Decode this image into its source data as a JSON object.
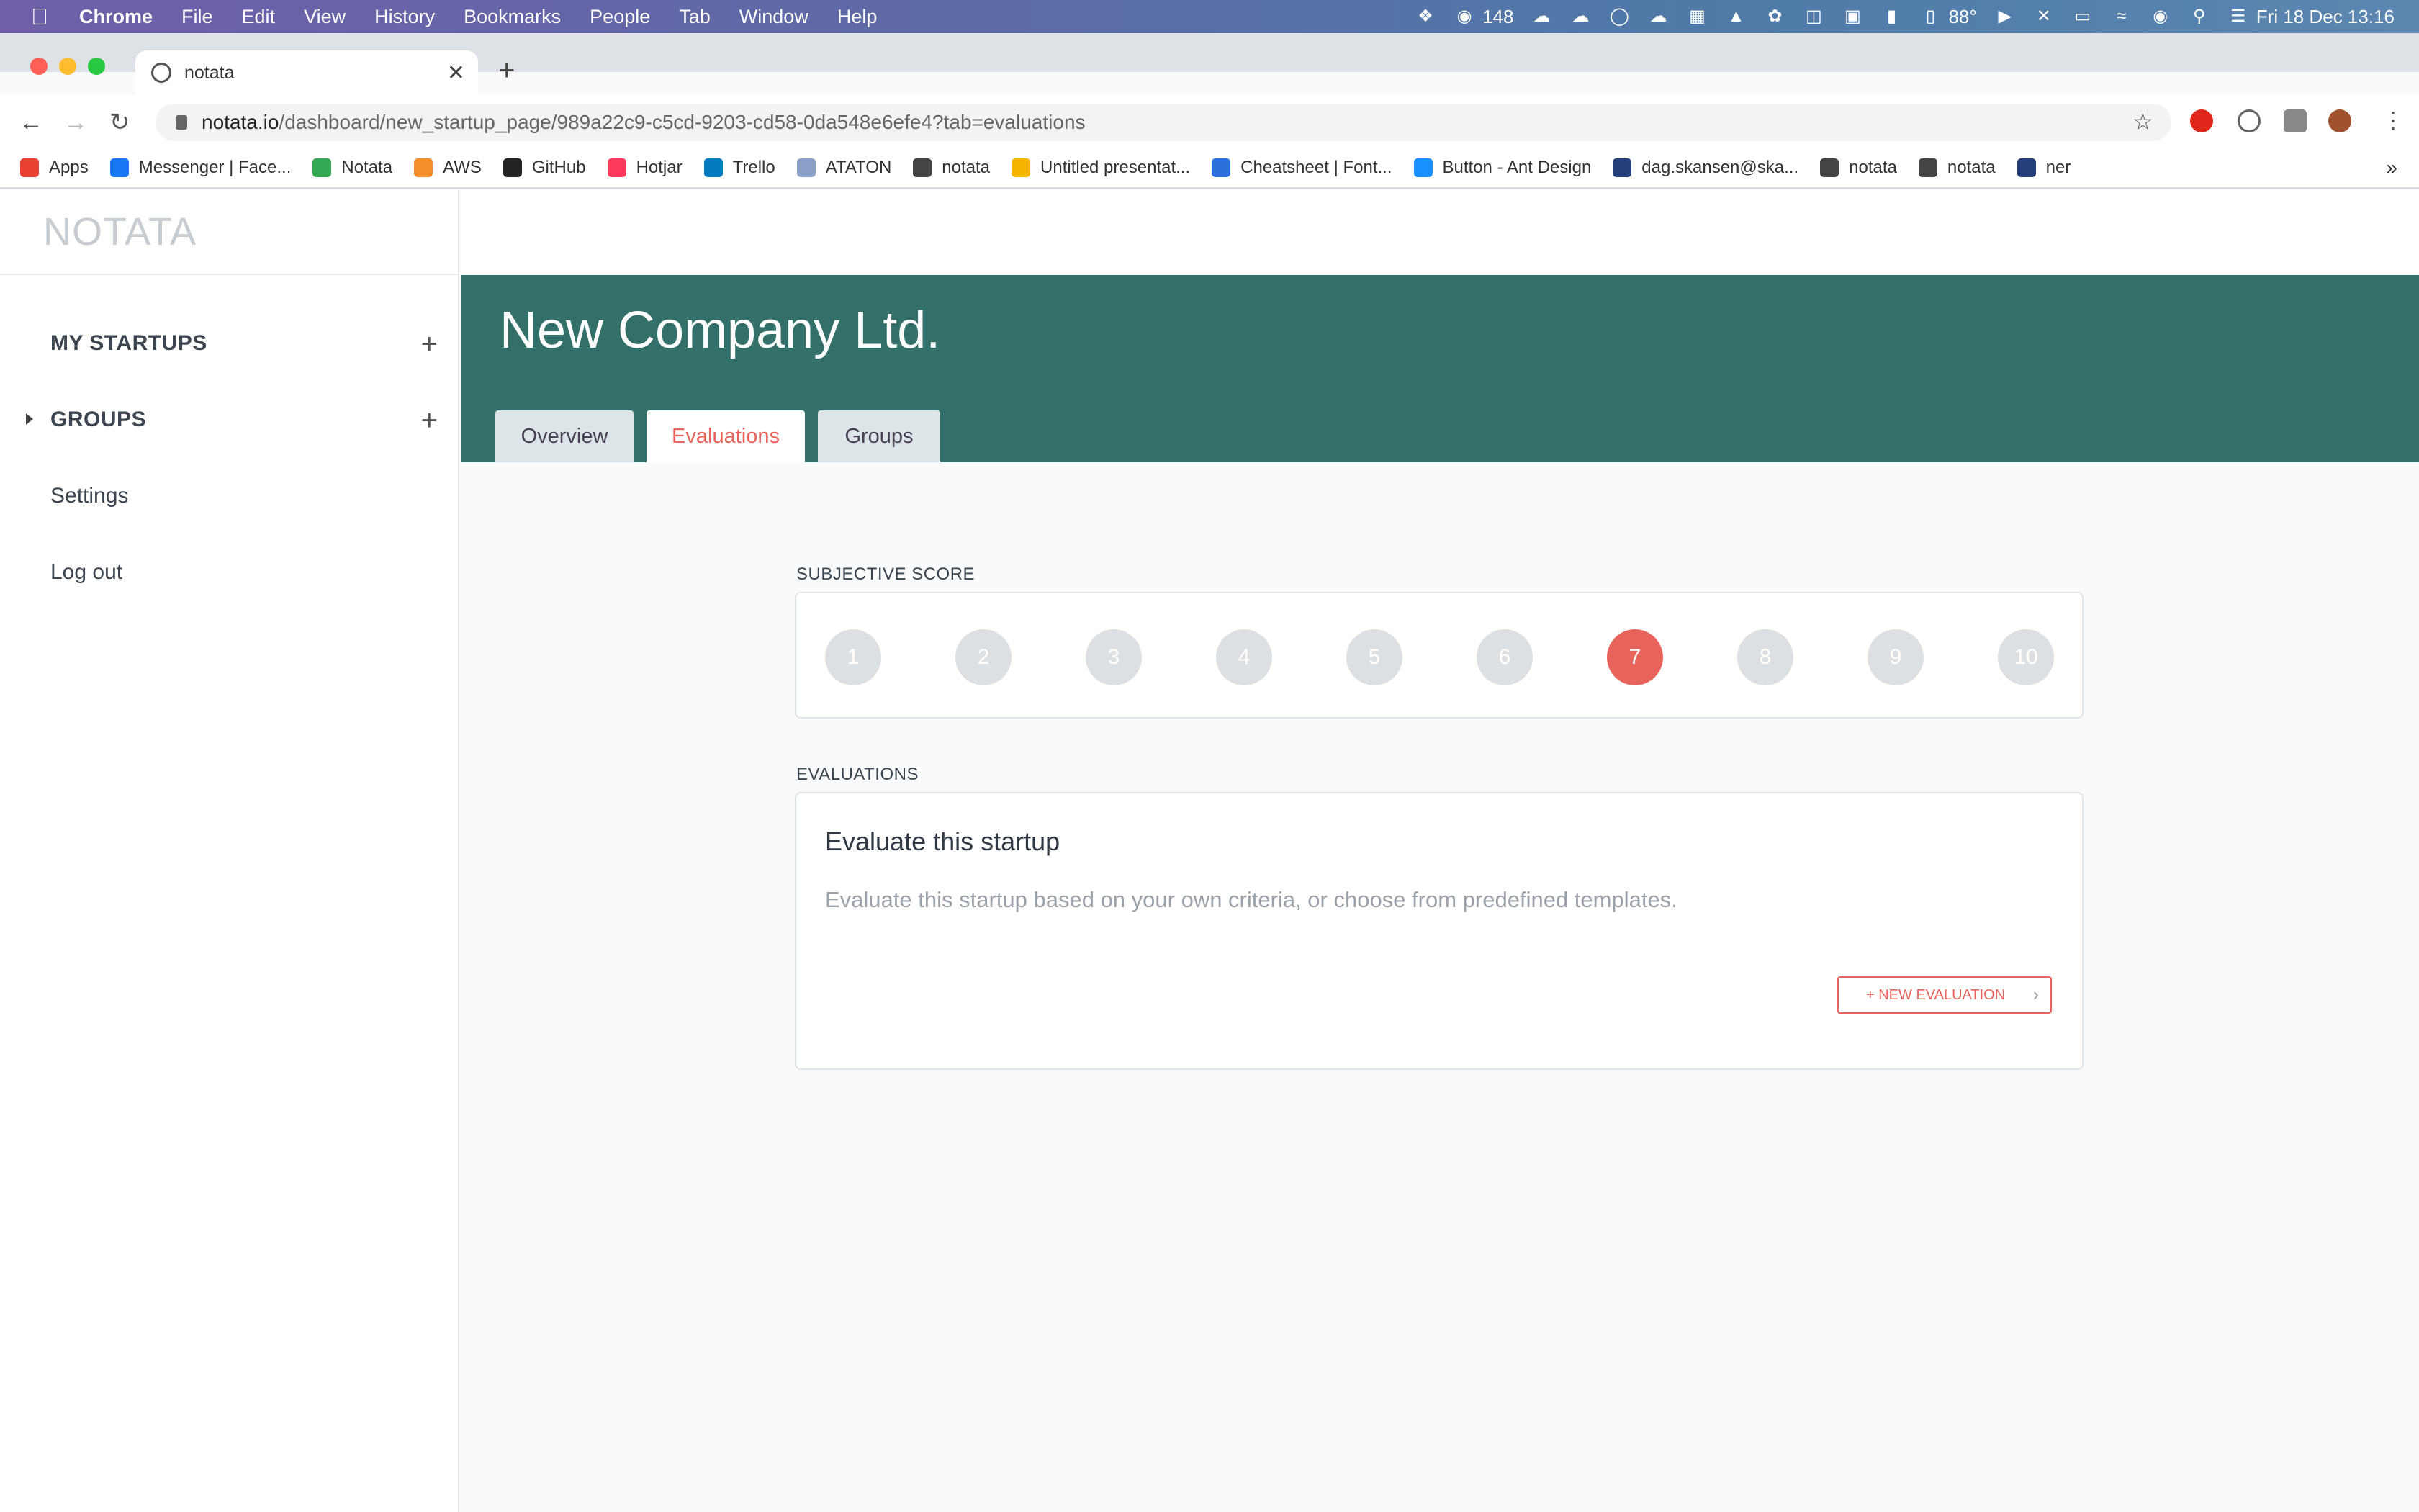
{
  "menubar": {
    "app_name": "Chrome",
    "items": [
      "File",
      "Edit",
      "View",
      "History",
      "Bookmarks",
      "People",
      "Tab",
      "Window",
      "Help"
    ],
    "badge_count": "148",
    "temperature": "88°",
    "datetime": "Fri 18 Dec  13:16"
  },
  "browser": {
    "tab_title": "notata",
    "url_host": "notata.io",
    "url_path": "/dashboard/new_startup_page/989a22c9-c5cd-9203-cd58-0da548e6efe4?tab=evaluations",
    "bookmarks": [
      {
        "label": "Apps",
        "color": "#e94235"
      },
      {
        "label": "Messenger | Face...",
        "color": "#1877f2"
      },
      {
        "label": "Notata",
        "color": "#34a853"
      },
      {
        "label": "AWS",
        "color": "#f4902b"
      },
      {
        "label": "GitHub",
        "color": "#222222"
      },
      {
        "label": "Hotjar",
        "color": "#fd3a5c"
      },
      {
        "label": "Trello",
        "color": "#0079bf"
      },
      {
        "label": "ATATON",
        "color": "#8aa0c8"
      },
      {
        "label": "notata",
        "color": "#444444"
      },
      {
        "label": "Untitled presentat...",
        "color": "#f4b400"
      },
      {
        "label": "Cheatsheet | Font...",
        "color": "#2a6fdb"
      },
      {
        "label": "Button - Ant Design",
        "color": "#1890ff"
      },
      {
        "label": "dag.skansen@ska...",
        "color": "#23407a"
      },
      {
        "label": "notata",
        "color": "#444444"
      },
      {
        "label": "notata",
        "color": "#444444"
      },
      {
        "label": "ner",
        "color": "#23407a"
      }
    ],
    "more": "»"
  },
  "sidebar": {
    "logo": "NOTATA",
    "my_startups": "MY STARTUPS",
    "groups": "GROUPS",
    "settings": "Settings",
    "logout": "Log out"
  },
  "header": {
    "company_name": "New Company Ltd.",
    "tabs": [
      "Overview",
      "Evaluations",
      "Groups"
    ],
    "active_tab": "Evaluations"
  },
  "subjective_score": {
    "label": "SUBJECTIVE SCORE",
    "options": [
      "1",
      "2",
      "3",
      "4",
      "5",
      "6",
      "7",
      "8",
      "9",
      "10"
    ],
    "selected": "7"
  },
  "evaluations": {
    "label": "EVALUATIONS",
    "card_title": "Evaluate this startup",
    "card_description": "Evaluate this startup based on your own criteria, or choose from predefined templates.",
    "button_label": "+ NEW EVALUATION"
  },
  "colors": {
    "brand_green": "#33706a",
    "accent_red": "#e8635c"
  }
}
